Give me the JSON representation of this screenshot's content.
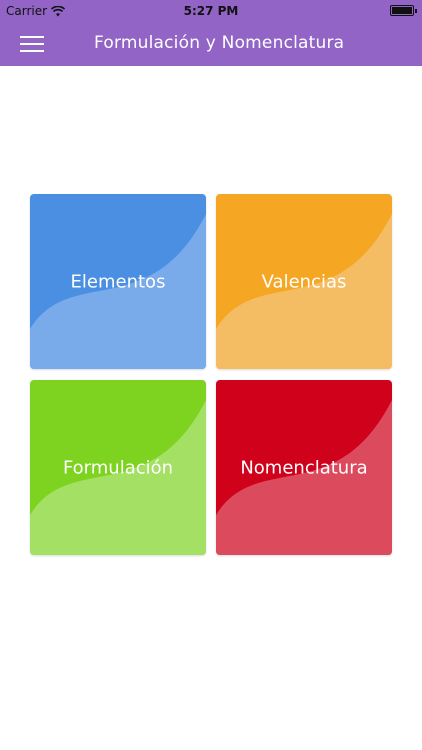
{
  "status_bar": {
    "carrier": "Carrier",
    "time": "5:27 PM",
    "wifi_icon": "wifi-icon",
    "battery_icon": "battery-icon"
  },
  "nav": {
    "title": "Formulación y Nomenclatura",
    "menu_icon": "hamburger-menu-icon"
  },
  "tiles": [
    {
      "label": "Elementos",
      "dark": "#4a8fe2",
      "light": "#79aae9"
    },
    {
      "label": "Valencias",
      "dark": "#f5a623",
      "light": "#f5bd63"
    },
    {
      "label": "Formulación",
      "dark": "#7ed321",
      "light": "#a4e063"
    },
    {
      "label": "Nomenclatura",
      "dark": "#d0021b",
      "light": "#dc4a5e"
    }
  ],
  "colors": {
    "accent": "#9264c6",
    "background": "#ffffff"
  }
}
